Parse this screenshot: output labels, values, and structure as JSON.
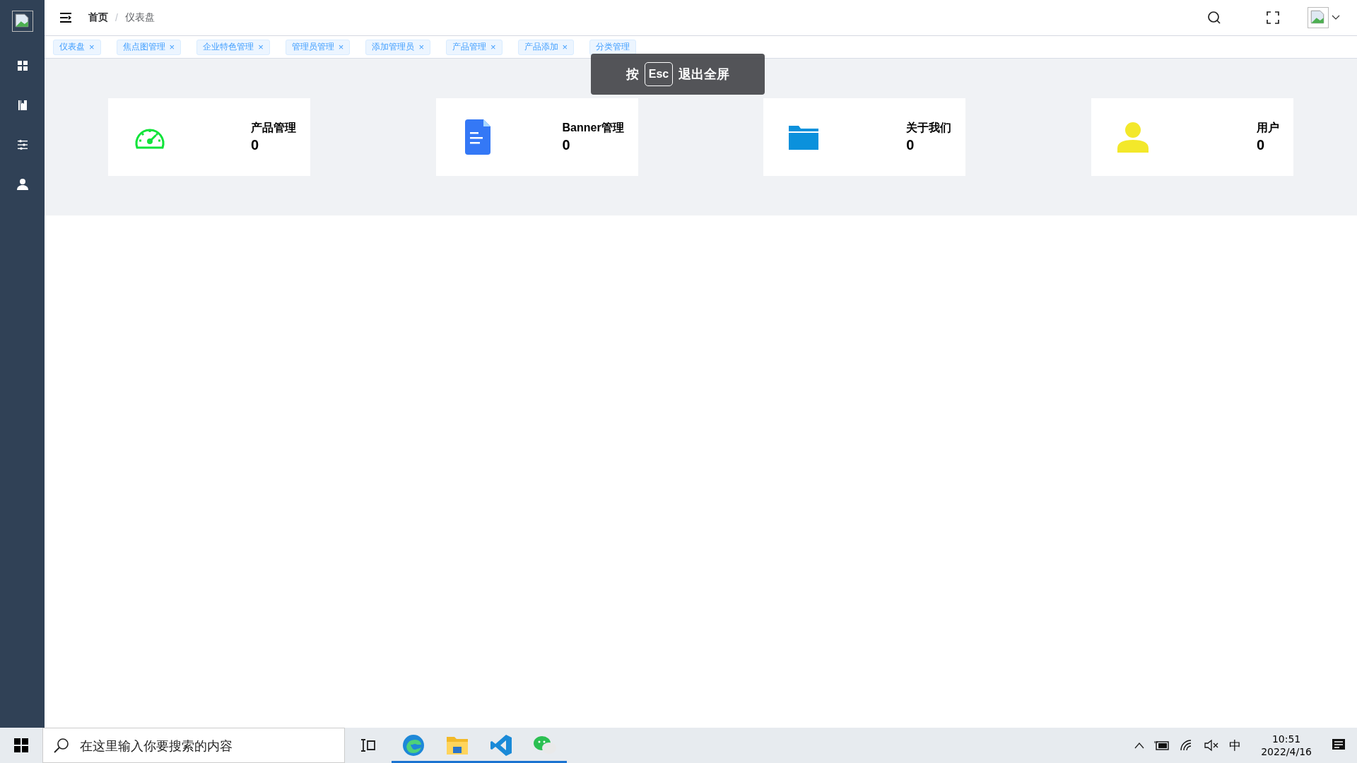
{
  "sidebar": {
    "items": [
      {
        "kind": "grid"
      },
      {
        "kind": "book"
      },
      {
        "kind": "sliders"
      },
      {
        "kind": "user"
      }
    ]
  },
  "header": {
    "breadcrumb": [
      "首页",
      "仪表盘"
    ],
    "separator": "/"
  },
  "tags": [
    {
      "label": "仪表盘",
      "close": "×"
    },
    {
      "label": "焦点图管理",
      "close": "×"
    },
    {
      "label": "企业特色管理",
      "close": "×"
    },
    {
      "label": "管理员管理",
      "close": "×"
    },
    {
      "label": "添加管理员",
      "close": "×"
    },
    {
      "label": "产品管理",
      "close": "×"
    },
    {
      "label": "产品添加",
      "close": "×"
    },
    {
      "label": "分类管理"
    }
  ],
  "fullscreen_notice": {
    "before": "按",
    "key": "Esc",
    "after": "退出全屏"
  },
  "cards": [
    {
      "kind": "speedometer",
      "label": "产品管理",
      "value": "0",
      "color": "#10e43a"
    },
    {
      "kind": "document",
      "label": "Banner管理",
      "value": "0",
      "color": "#3478f6"
    },
    {
      "kind": "folder",
      "label": "关于我们",
      "value": "0",
      "color": "#0b91dc"
    },
    {
      "kind": "person",
      "label": "用户",
      "value": "0",
      "color": "#f3e82a"
    }
  ],
  "taskbar": {
    "search": {
      "placeholder": "在这里输入你要搜索的内容"
    },
    "apps": [
      {
        "kind": "browser",
        "running": true
      },
      {
        "kind": "folder",
        "running": true
      },
      {
        "kind": "editor",
        "running": true
      },
      {
        "kind": "chat",
        "running": true
      }
    ],
    "ime": "中",
    "time": "10:51",
    "date": "2022/4/16"
  }
}
